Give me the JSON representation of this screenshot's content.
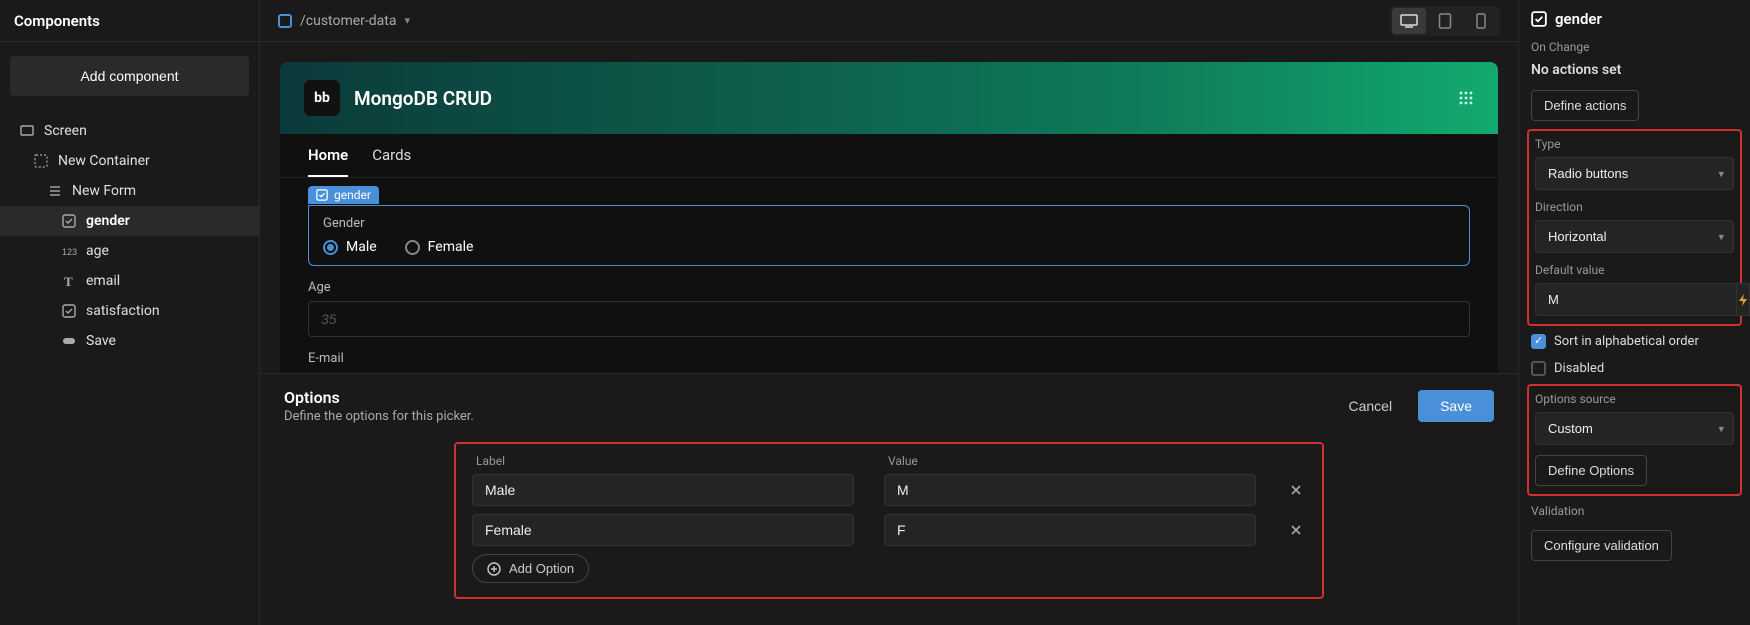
{
  "leftSidebar": {
    "title": "Components",
    "addButton": "Add component",
    "tree": [
      {
        "label": "Screen",
        "icon": "screen",
        "indent": 0,
        "selected": false
      },
      {
        "label": "New Container",
        "icon": "container",
        "indent": 1,
        "selected": false
      },
      {
        "label": "New Form",
        "icon": "form",
        "indent": 2,
        "selected": false
      },
      {
        "label": "gender",
        "icon": "options",
        "indent": 3,
        "selected": true
      },
      {
        "label": "age",
        "icon": "number",
        "indent": 3,
        "selected": false
      },
      {
        "label": "email",
        "icon": "text",
        "indent": 3,
        "selected": false
      },
      {
        "label": "satisfaction",
        "icon": "options",
        "indent": 3,
        "selected": false
      },
      {
        "label": "Save",
        "icon": "button",
        "indent": 3,
        "selected": false
      }
    ]
  },
  "topBar": {
    "breadcrumb": "/customer-data",
    "devices": {
      "desktopActive": true
    }
  },
  "canvas": {
    "appTitle": "MongoDB CRUD",
    "logoText": "bb",
    "tabs": [
      {
        "label": "Home",
        "active": true
      },
      {
        "label": "Cards",
        "active": false
      }
    ],
    "badgeLabel": "gender",
    "genderField": {
      "label": "Gender",
      "options": [
        {
          "label": "Male",
          "checked": true
        },
        {
          "label": "Female",
          "checked": false
        }
      ]
    },
    "ageField": {
      "label": "Age",
      "placeholder": "35"
    },
    "emailField": {
      "label": "E-mail"
    }
  },
  "optionsPanel": {
    "title": "Options",
    "subtitle": "Define the options for this picker.",
    "cancel": "Cancel",
    "save": "Save",
    "colLabel": "Label",
    "colValue": "Value",
    "rows": [
      {
        "label": "Male",
        "value": "M"
      },
      {
        "label": "Female",
        "value": "F"
      }
    ],
    "addOption": "Add Option"
  },
  "rightSidebar": {
    "componentName": "gender",
    "onChangeLabel": "On Change",
    "onChangeValue": "No actions set",
    "defineActions": "Define actions",
    "typeLabel": "Type",
    "typeValue": "Radio buttons",
    "directionLabel": "Direction",
    "directionValue": "Horizontal",
    "defaultLabel": "Default value",
    "defaultValue": "M",
    "sortLabel": "Sort in alphabetical order",
    "sortChecked": true,
    "disabledLabel": "Disabled",
    "disabledChecked": false,
    "optionsSourceLabel": "Options source",
    "optionsSourceValue": "Custom",
    "defineOptions": "Define Options",
    "validationLabel": "Validation",
    "configureValidation": "Configure validation"
  }
}
